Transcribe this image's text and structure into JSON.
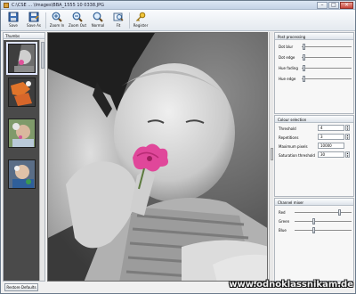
{
  "window": {
    "title": "C:\\CSE ... \\Images\\BBA_1555 10 0338.JPG",
    "minimize_glyph": "–",
    "maximize_glyph": "□",
    "close_glyph": "×"
  },
  "toolbar": [
    {
      "key": "save",
      "label": "Save",
      "icon": "floppy-disk-icon"
    },
    {
      "key": "save_as",
      "label": "Save As",
      "icon": "floppy-disk-icon"
    },
    {
      "key": "zoom_in",
      "label": "Zoom In",
      "icon": "magnifier-plus-icon"
    },
    {
      "key": "zoom_out",
      "label": "Zoom Out",
      "icon": "magnifier-minus-icon"
    },
    {
      "key": "normal",
      "label": "Normal",
      "icon": "magnifier-icon"
    },
    {
      "key": "fit",
      "label": "Fit",
      "icon": "fit-window-icon"
    },
    {
      "key": "register",
      "label": "Register",
      "icon": "key-icon"
    }
  ],
  "thumbs": {
    "header": "Thumbs",
    "items": [
      {
        "name": "thumbnail-1",
        "selected": true
      },
      {
        "name": "thumbnail-2",
        "selected": false
      },
      {
        "name": "thumbnail-3",
        "selected": false
      },
      {
        "name": "thumbnail-4",
        "selected": false
      }
    ]
  },
  "restore_defaults": "Restore Defaults",
  "post_processing": {
    "title": "Post processing",
    "rows": [
      {
        "label": "Dot blur",
        "value": 0.06
      },
      {
        "label": "Dot edge",
        "value": 0.06
      },
      {
        "label": "Hue fading",
        "value": 0.06
      },
      {
        "label": "Hue edge",
        "value": 0.06
      }
    ]
  },
  "colour_selection": {
    "title": "Colour selection",
    "threshold": {
      "label": "Threshold",
      "value": "4"
    },
    "repetitions": {
      "label": "Repetitions",
      "value": "3"
    },
    "maximum_pixels": {
      "label": "Maximum pixels",
      "value": "10000"
    },
    "saturation_threshold": {
      "label": "Saturation threshold",
      "value": "30"
    }
  },
  "channel_mixer": {
    "title": "Channel mixer",
    "rows": [
      {
        "label": "Red",
        "value": 0.8
      },
      {
        "label": "Green",
        "value": 0.35
      },
      {
        "label": "Blue",
        "value": 0.35
      }
    ]
  },
  "watermark": "www.odnoklassnikam.de"
}
